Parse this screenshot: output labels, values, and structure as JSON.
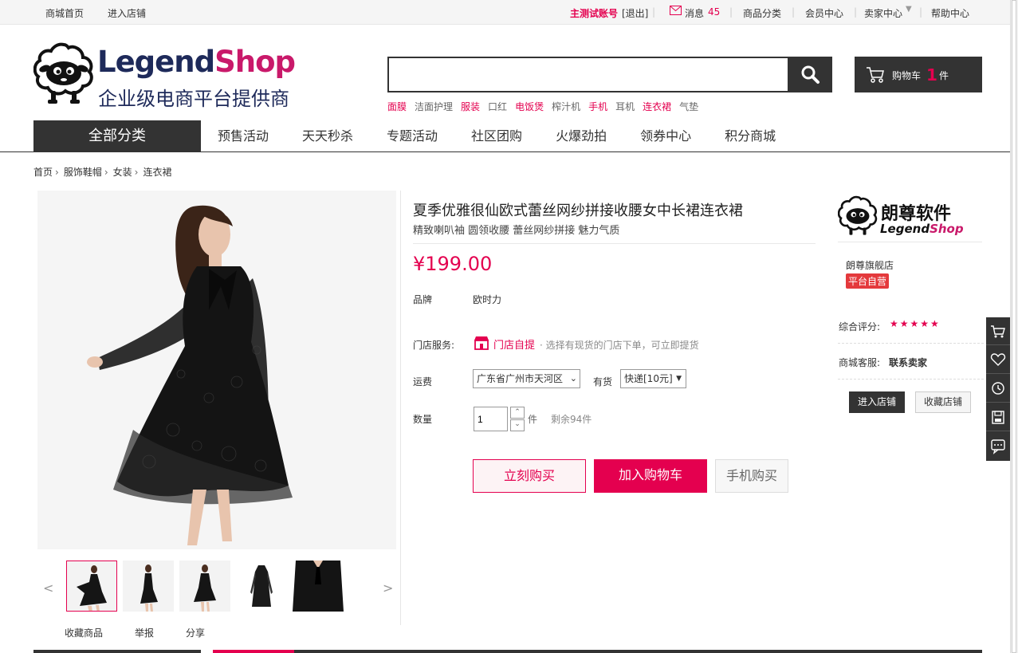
{
  "topbar": {
    "home": "商城首页",
    "enter_store": "进入店铺",
    "account": "主测试账号",
    "logout": "[退出]",
    "messages_label": "消息",
    "messages_count": "45",
    "categories": "商品分类",
    "member": "会员中心",
    "seller": "卖家中心",
    "help": "帮助中心"
  },
  "header": {
    "logo_part1": "Legend",
    "logo_part2": "Shop",
    "logo_tagline": "企业级电商平台提供商",
    "search_value": "",
    "hotwords": [
      {
        "text": "面膜",
        "hot": true
      },
      {
        "text": "洁面护理",
        "hot": false
      },
      {
        "text": "服装",
        "hot": true
      },
      {
        "text": "口红",
        "hot": false
      },
      {
        "text": "电饭煲",
        "hot": true
      },
      {
        "text": "榨汁机",
        "hot": false
      },
      {
        "text": "手机",
        "hot": true
      },
      {
        "text": "耳机",
        "hot": false
      },
      {
        "text": "连衣裙",
        "hot": true
      },
      {
        "text": "气垫",
        "hot": false
      }
    ],
    "cart_label": "购物车",
    "cart_count": "1",
    "cart_unit": "件"
  },
  "nav": {
    "all_categories": "全部分类",
    "items": [
      "预售活动",
      "天天秒杀",
      "专题活动",
      "社区团购",
      "火爆劲拍",
      "领券中心",
      "积分商城"
    ]
  },
  "breadcrumb": [
    "首页",
    "服饰鞋帽",
    "女装",
    "连衣裙"
  ],
  "product": {
    "title": "夏季优雅很仙欧式蕾丝网纱拼接收腰女中长裙连衣裙",
    "subtitle": "精致喇叭袖 圆领收腰 蕾丝网纱拼接 魅力气质",
    "price": "¥199.00",
    "brand_label": "品牌",
    "brand_value": "欧时力",
    "service_label": "门店服务:",
    "service_name": "门店自提",
    "service_desc": "· 选择有现货的门店下单，可立即提货",
    "shipping_label": "运费",
    "shipping_region": "广东省广州市天河区",
    "stock_status": "有货",
    "shipping_method": "快递[10元]",
    "qty_label": "数量",
    "qty_value": "1",
    "qty_unit": "件",
    "remaining": "剩余94件",
    "buy_now": "立刻购买",
    "add_cart": "加入购物车",
    "mobile_buy": "手机购买"
  },
  "gallery": {
    "prev": "<",
    "next": ">",
    "actions": [
      "收藏商品",
      "举报",
      "分享"
    ]
  },
  "store": {
    "logo_cn": "朗尊软件",
    "logo_en1": "Legend",
    "logo_en2": "Shop",
    "name": "朗尊旗舰店",
    "badge": "平台自营",
    "rating_label": "综合评分:",
    "rating_stars": 5,
    "service_label": "商城客服:",
    "service_link": "联系卖家",
    "enter_btn": "进入店铺",
    "fav_btn": "收藏店铺"
  },
  "colors": {
    "accent": "#e4004f",
    "dark": "#333333",
    "logo_navy": "#1e2a5a",
    "logo_pink": "#c9196a"
  }
}
